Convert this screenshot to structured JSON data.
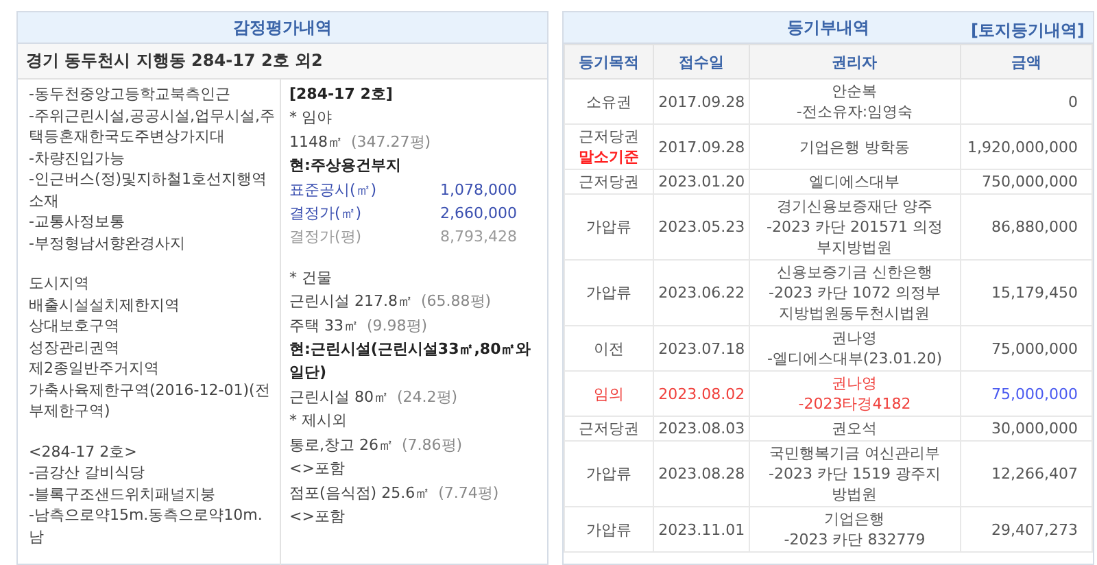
{
  "appraisal": {
    "title": "감정평가내역",
    "address": "경기 동두천시 지행동 284-17 2호 외2",
    "notes": [
      [
        "-동두천중앙고등학교북측인근",
        "-주위근린시설,공공시설,업무시설,주택등혼재한국도주변상가지대",
        "-차량진입가능",
        "-인근버스(정)및지하철1호선지행역소재",
        "-교통사정보통",
        "-부정형남서향완경사지"
      ],
      [
        "도시지역",
        "배출시설설치제한지역",
        "상대보호구역",
        "성장관리권역",
        "제2종일반주거지역",
        "가축사육제한구역(2016-12-01)(전부제한구역)"
      ],
      [
        "<284-17 2호>",
        "-금강산 갈비식당",
        "-블록구조샌드위치패널지붕",
        "-남측으로약15m.동측으로약10m.남"
      ]
    ],
    "details": [
      {
        "kind": "bold",
        "text": "[284-17 2호]"
      },
      {
        "kind": "text",
        "text": "* 임야"
      },
      {
        "kind": "area",
        "text": "1148㎡",
        "sub": "(347.27평)"
      },
      {
        "kind": "bold",
        "text": "현:주상용건부지"
      },
      {
        "kind": "price",
        "label": "표준공시(㎡)",
        "value": "1,078,000",
        "muted": false
      },
      {
        "kind": "price",
        "label": "결정가(㎡)",
        "value": "2,660,000",
        "muted": false
      },
      {
        "kind": "price",
        "label": "결정가(평)",
        "value": "8,793,428",
        "muted": true
      },
      {
        "kind": "gap"
      },
      {
        "kind": "text",
        "text": "* 건물"
      },
      {
        "kind": "area",
        "text": "근린시설 217.8㎡",
        "sub": "(65.88평)"
      },
      {
        "kind": "area",
        "text": "주택 33㎡",
        "sub": "(9.98평)"
      },
      {
        "kind": "bold",
        "text": "현:근린시설(근린시설33㎡,80㎡와일단)"
      },
      {
        "kind": "area",
        "text": "근린시설 80㎡",
        "sub": "(24.2평)"
      },
      {
        "kind": "text",
        "text": "* 제시외"
      },
      {
        "kind": "area",
        "text": "통로,창고 26㎡",
        "sub": "(7.86평)"
      },
      {
        "kind": "text",
        "text": "<>포함"
      },
      {
        "kind": "area",
        "text": "점포(음식점) 25.6㎡",
        "sub": "(7.74평)"
      },
      {
        "kind": "text",
        "text": "<>포함"
      }
    ]
  },
  "registry": {
    "title": "등기부내역",
    "link": "[토지등기내역]",
    "columns": [
      "등기목적",
      "접수일",
      "권리자",
      "금액"
    ],
    "rows": [
      {
        "kind": "normal",
        "purpose": "소유권",
        "date": "2017.09.28",
        "holder": [
          "안순복",
          "-전소유자:임영숙"
        ],
        "amount": "0"
      },
      {
        "kind": "normal",
        "purpose": "근저당권",
        "note": "말소기준",
        "date": "2017.09.28",
        "holder": [
          "기업은행 방학동"
        ],
        "amount": "1,920,000,000"
      },
      {
        "kind": "normal",
        "purpose": "근저당권",
        "date": "2023.01.20",
        "holder": [
          "엘디에스대부"
        ],
        "amount": "750,000,000"
      },
      {
        "kind": "normal",
        "purpose": "가압류",
        "date": "2023.05.23",
        "holder": [
          "경기신용보증재단 양주",
          "-2023 카단 201571 의정",
          "부지방법원"
        ],
        "amount": "86,880,000"
      },
      {
        "kind": "normal",
        "purpose": "가압류",
        "date": "2023.06.22",
        "holder": [
          "신용보증기금 신한은행",
          "-2023 카단 1072 의정부",
          "지방법원동두천시법원"
        ],
        "amount": "15,179,450"
      },
      {
        "kind": "normal",
        "purpose": "이전",
        "date": "2023.07.18",
        "holder": [
          "권나영",
          "-엘디에스대부(23.01.20)"
        ],
        "amount": "75,000,000"
      },
      {
        "kind": "auction",
        "purpose": "임의",
        "date": "2023.08.02",
        "holder": [
          "권나영",
          "-2023타경4182"
        ],
        "amount": "75,000,000"
      },
      {
        "kind": "normal",
        "purpose": "근저당권",
        "date": "2023.08.03",
        "holder": [
          "권오석"
        ],
        "amount": "30,000,000"
      },
      {
        "kind": "normal",
        "purpose": "가압류",
        "date": "2023.08.28",
        "holder": [
          "국민행복기금 여신관리부",
          "-2023 카단 1519 광주지",
          "방법원"
        ],
        "amount": "12,266,407"
      },
      {
        "kind": "normal",
        "purpose": "가압류",
        "date": "2023.11.01",
        "holder": [
          "기업은행",
          "-2023 카단 832779"
        ],
        "amount": "29,407,273"
      }
    ]
  }
}
